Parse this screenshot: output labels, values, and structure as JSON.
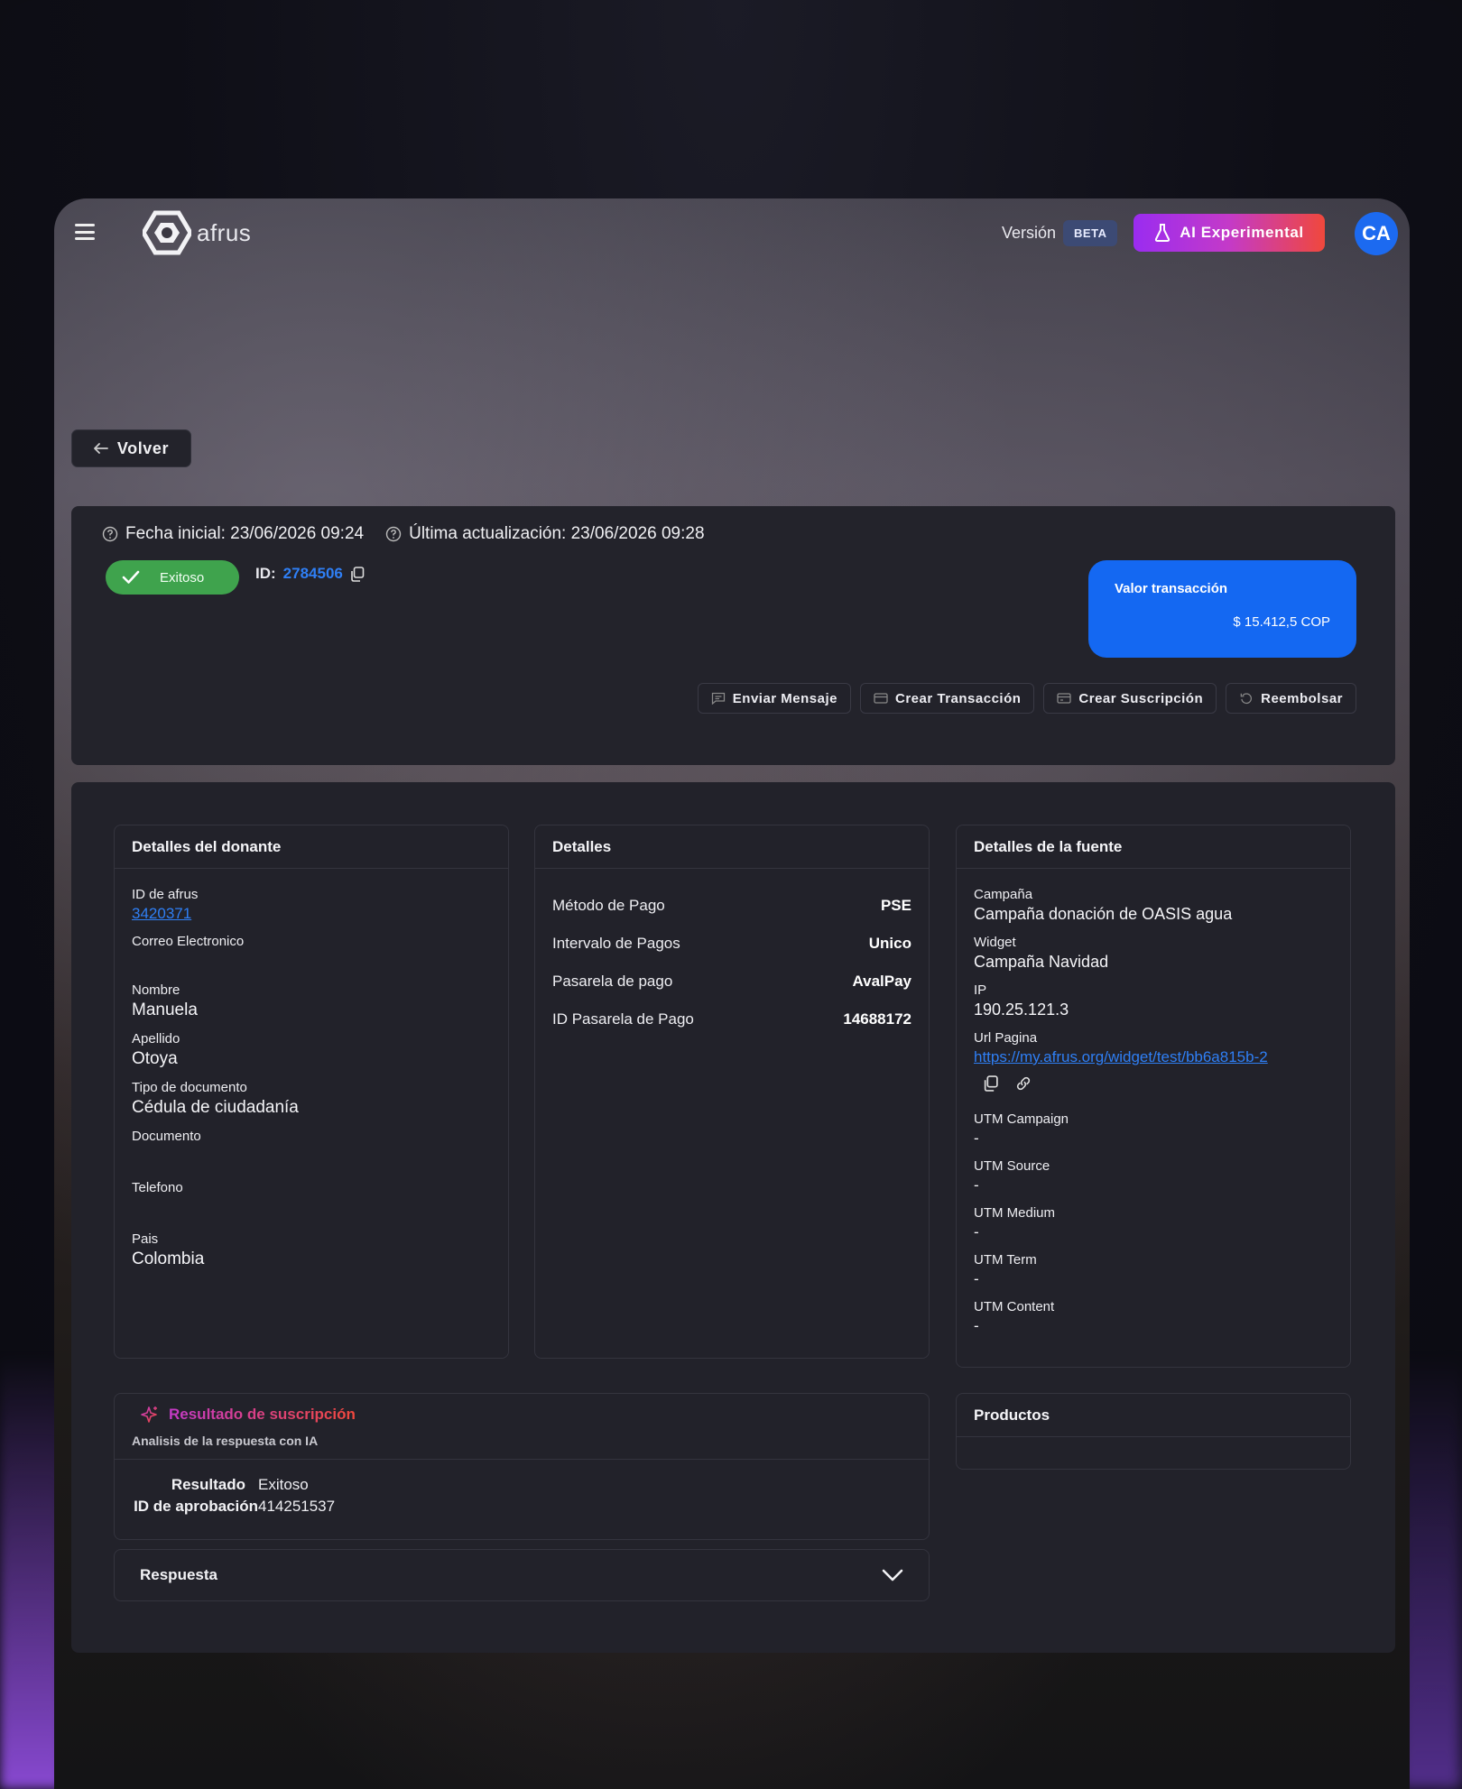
{
  "app": {
    "logo_text": "afrus",
    "version_label": "Versión",
    "beta_label": "BETA",
    "ai_label": "AI Experimental",
    "avatar_initials": "CA"
  },
  "back_label": "Volver",
  "summary": {
    "fecha_inicial": "Fecha inicial: 23/06/2026 09:24",
    "ultima_actualizacion": "Última actualización: 23/06/2026 09:28",
    "status": "Exitoso",
    "id_label": "ID:",
    "id_value": "2784506",
    "valor_title": "Valor transacción",
    "valor_amount": "$ 15.412,5 COP",
    "actions": {
      "enviar": "Enviar Mensaje",
      "crear_transaccion": "Crear Transacción",
      "crear_suscripcion": "Crear Suscripción",
      "reembolsar": "Reembolsar"
    }
  },
  "donor": {
    "title": "Detalles del donante",
    "id_label": "ID de afrus",
    "id_value": "3420371",
    "email_label": "Correo Electronico",
    "email_value": "",
    "nombre_label": "Nombre",
    "nombre_value": "Manuela",
    "apellido_label": "Apellido",
    "apellido_value": "Otoya",
    "tipo_doc_label": "Tipo de documento",
    "tipo_doc_value": "Cédula de ciudadanía",
    "documento_label": "Documento",
    "documento_value": "",
    "telefono_label": "Telefono",
    "telefono_value": "",
    "pais_label": "Pais",
    "pais_value": "Colombia"
  },
  "details": {
    "title": "Detalles",
    "rows": [
      {
        "k": "Método de Pago",
        "v": "PSE"
      },
      {
        "k": "Intervalo de Pagos",
        "v": "Unico"
      },
      {
        "k": "Pasarela de pago",
        "v": "AvalPay"
      },
      {
        "k": "ID Pasarela de Pago",
        "v": "14688172"
      }
    ]
  },
  "source": {
    "title": "Detalles de la fuente",
    "campana_label": "Campaña",
    "campana_value": "Campaña donación de OASIS agua",
    "widget_label": "Widget",
    "widget_value": "Campaña Navidad",
    "ip_label": "IP",
    "ip_value": "190.25.121.3",
    "url_label": "Url Pagina",
    "url_value": "https://my.afrus.org/widget/test/bb6a815b-2",
    "utm_campaign_label": "UTM Campaign",
    "utm_campaign_value": "-",
    "utm_source_label": "UTM Source",
    "utm_source_value": "-",
    "utm_medium_label": "UTM Medium",
    "utm_medium_value": "-",
    "utm_term_label": "UTM Term",
    "utm_term_value": "-",
    "utm_content_label": "UTM Content",
    "utm_content_value": "-"
  },
  "subscription": {
    "title": "Resultado de suscripción",
    "note": "Analisis de la respuesta con IA",
    "resultado_label": "Resultado",
    "resultado_value": "Exitoso",
    "aprobacion_label": "ID de aprobación",
    "aprobacion_value": "414251537"
  },
  "respuesta_label": "Respuesta",
  "productos_title": "Productos",
  "colors": {
    "accent_blue": "#1468f2",
    "success_green": "#3fa34d",
    "ai_gradient_start": "#9a2cf0",
    "ai_gradient_end": "#f0483c"
  }
}
